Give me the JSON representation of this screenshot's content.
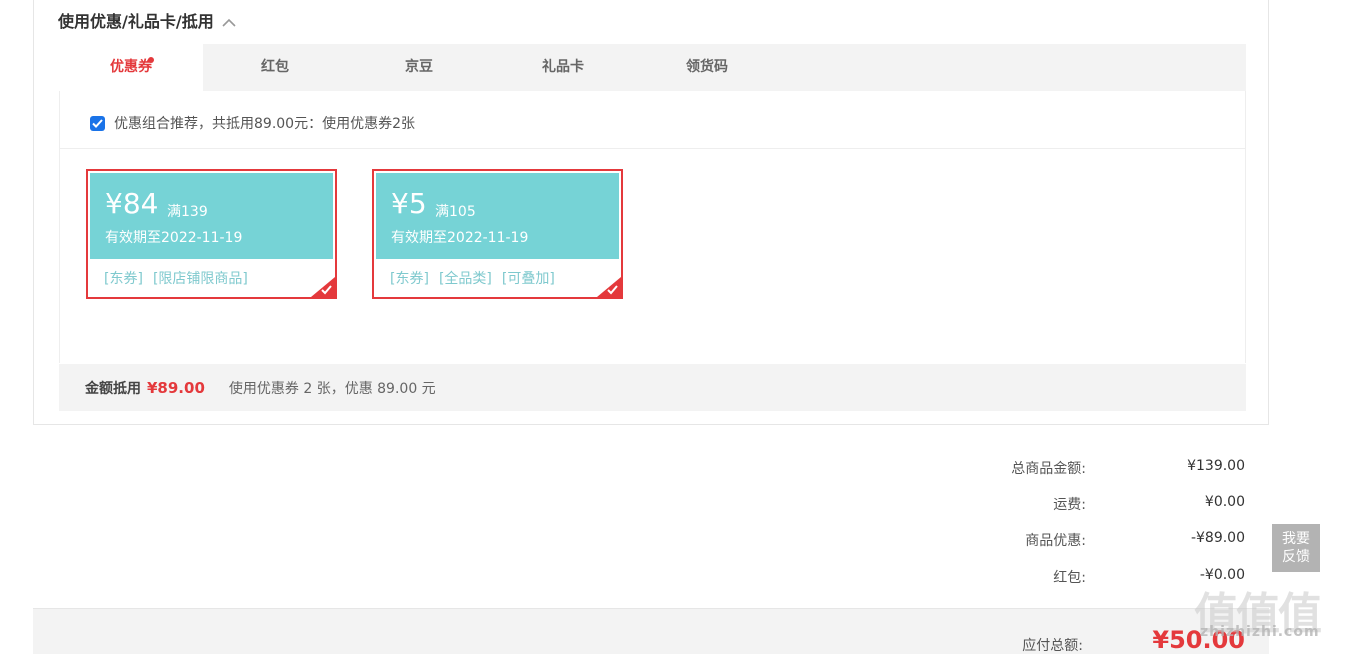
{
  "section": {
    "title": "使用优惠/礼品卡/抵用",
    "collapse_icon": "chevron-up-icon"
  },
  "tabs": [
    {
      "label": "优惠券",
      "active": true,
      "has_dot": true
    },
    {
      "label": "红包",
      "active": false
    },
    {
      "label": "京豆",
      "active": false
    },
    {
      "label": "礼品卡",
      "active": false
    },
    {
      "label": "领货码",
      "active": false
    }
  ],
  "combo": {
    "checked": true,
    "text": "优惠组合推荐，共抵用89.00元：使用优惠券2张"
  },
  "coupons": [
    {
      "amount": "¥84",
      "condition": "满139",
      "valid": "有效期至2022-11-19",
      "tags": [
        "[东券]",
        "[限店铺限商品]"
      ],
      "selected": true
    },
    {
      "amount": "¥5",
      "condition": "满105",
      "valid": "有效期至2022-11-19",
      "tags": [
        "[东券]",
        "[全品类]",
        "[可叠加]"
      ],
      "selected": true
    }
  ],
  "summary": {
    "label": "金额抵用",
    "amount": "¥89.00",
    "desc": "使用优惠券 2 张，优惠 89.00 元"
  },
  "totals": [
    {
      "label": "总商品金额:",
      "value": "¥139.00"
    },
    {
      "label": "运费:",
      "value": "¥0.00"
    },
    {
      "label": "商品优惠:",
      "value": "-¥89.00"
    },
    {
      "label": "红包:",
      "value": "-¥0.00"
    }
  ],
  "payable": {
    "label": "应付总额:",
    "value": "¥50.00"
  },
  "feedback": {
    "line1": "我要",
    "line2": "反馈"
  },
  "watermark": {
    "glyphs": "值值值",
    "domain": "zhizhizhi.com"
  },
  "colors": {
    "accent": "#e4393c",
    "coupon_bg": "#76d3d6",
    "checkbox": "#1a73e8"
  }
}
